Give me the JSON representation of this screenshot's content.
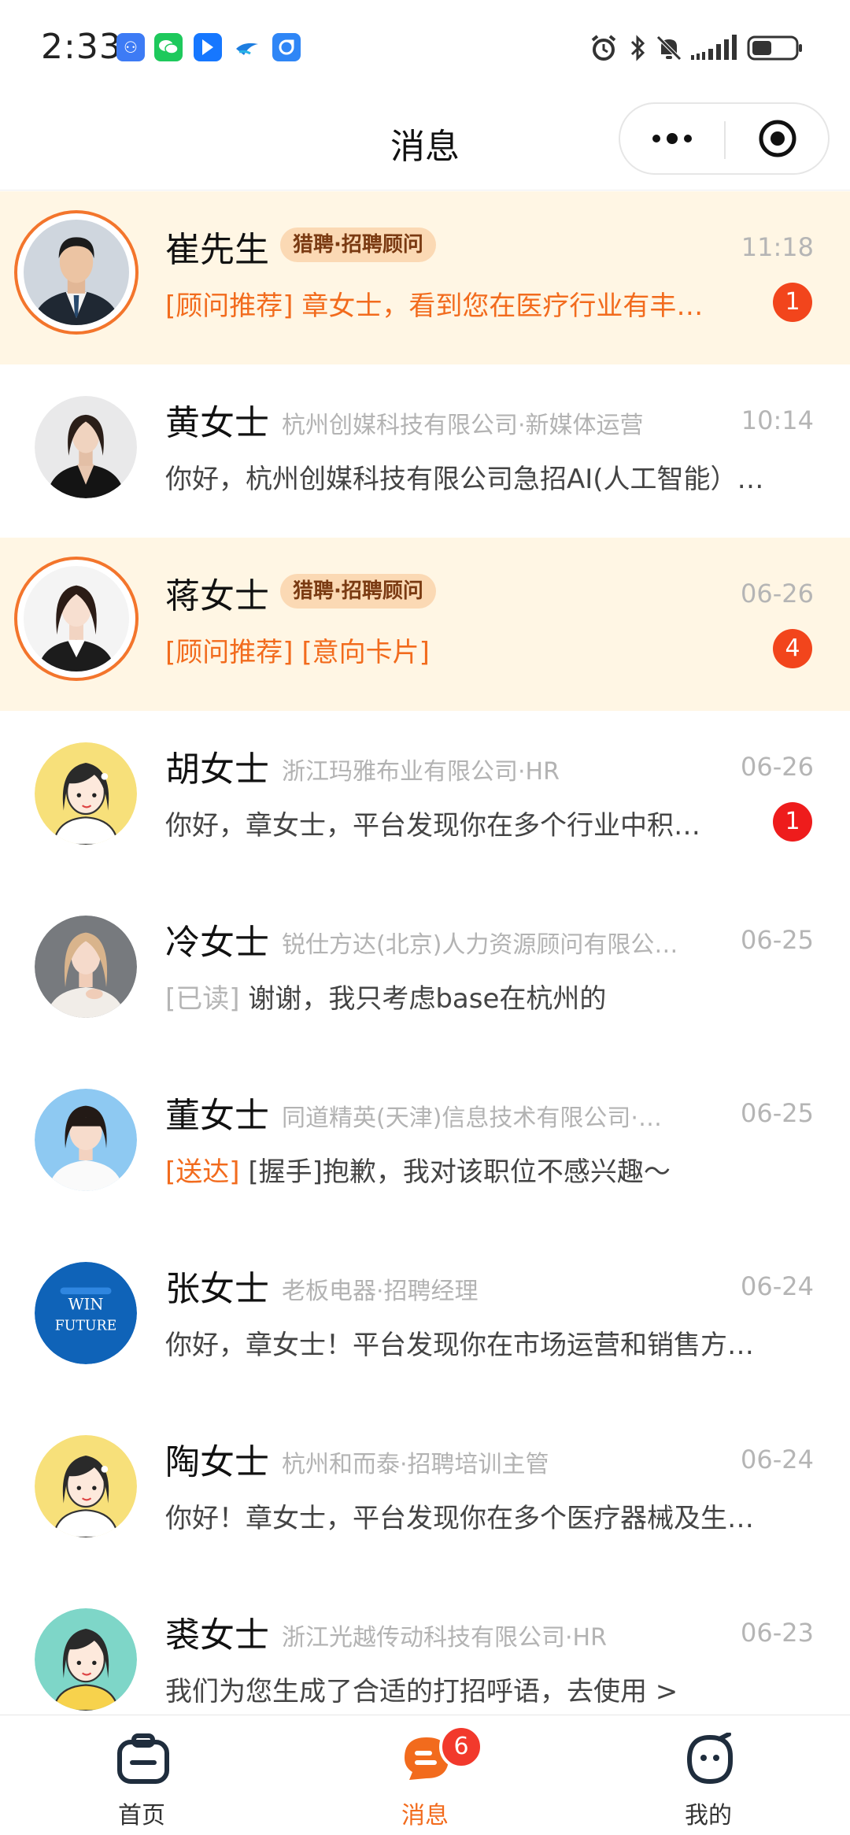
{
  "status_bar": {
    "time": "2:33",
    "app_icons": [
      "app-a-icon",
      "wechat-icon",
      "app-b-icon",
      "app-c-icon",
      "app-d-icon"
    ],
    "system_icons": [
      "alarm-icon",
      "bluetooth-icon",
      "mute-icon",
      "signal-icon",
      "battery-icon"
    ]
  },
  "nav": {
    "title": "消息"
  },
  "messages": [
    {
      "name": "崔先生",
      "tag": "猎聘·招聘顾问",
      "company": "",
      "time": "11:18",
      "prefix": "[顾问推荐]",
      "text": " 章女士，看到您在医疗行业有丰…",
      "badge": "1",
      "pinned": true
    },
    {
      "name": "黄女士",
      "tag": "",
      "company": "杭州创媒科技有限公司·新媒体运营",
      "time": "10:14",
      "prefix": "",
      "text": "你好，杭州创媒科技有限公司急招AI(人工智能）…",
      "badge": "",
      "pinned": false
    },
    {
      "name": "蒋女士",
      "tag": "猎聘·招聘顾问",
      "company": "",
      "time": "06-26",
      "prefix": "[顾问推荐] [意向卡片]",
      "text": "",
      "badge": "4",
      "pinned": true
    },
    {
      "name": "胡女士",
      "tag": "",
      "company": "浙江玛雅布业有限公司·HR",
      "time": "06-26",
      "prefix": "",
      "text": "你好，章女士，平台发现你在多个行业中积…",
      "badge": "1",
      "pinned": false
    },
    {
      "name": "冷女士",
      "tag": "",
      "company": "锐仕方达(北京)人力资源顾问有限公…",
      "time": "06-25",
      "prefix_grey": "[已读]",
      "text": " 谢谢，我只考虑base在杭州的",
      "badge": "",
      "pinned": false
    },
    {
      "name": "董女士",
      "tag": "",
      "company": "同道精英(天津)信息技术有限公司·…",
      "time": "06-25",
      "prefix": "[送达]",
      "text": " [握手]抱歉，我对该职位不感兴趣～",
      "badge": "",
      "pinned": false
    },
    {
      "name": "张女士",
      "tag": "",
      "company": "老板电器·招聘经理",
      "time": "06-24",
      "prefix": "",
      "text": "你好，章女士！平台发现你在市场运营和销售方…",
      "badge": "",
      "pinned": false
    },
    {
      "name": "陶女士",
      "tag": "",
      "company": "杭州和而泰·招聘培训主管",
      "time": "06-24",
      "prefix": "",
      "text": "你好！章女士，平台发现你在多个医疗器械及生…",
      "badge": "",
      "pinned": false
    },
    {
      "name": "裘女士",
      "tag": "",
      "company": "浙江光越传动科技有限公司·HR",
      "time": "06-23",
      "prefix": "",
      "text": "我们为您生成了合适的打招呼语，去使用 >",
      "badge": "",
      "pinned": false
    }
  ],
  "avatar_texts": {
    "zhang_logo": "WIN THE FUTURE"
  },
  "tab_bar": {
    "home": "首页",
    "messages": "消息",
    "messages_badge": "6",
    "mine": "我的"
  },
  "colors": {
    "accent": "#f26b1d",
    "pinned_bg": "#fff6e4",
    "tag_bg": "#fbd9b4",
    "badge_red": "#ee1c1c"
  }
}
